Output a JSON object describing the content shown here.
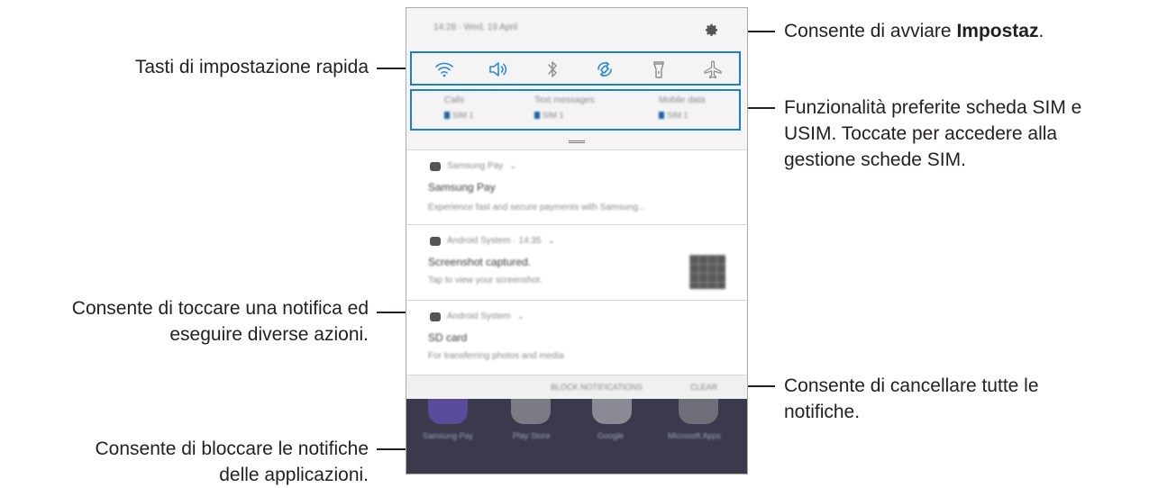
{
  "callouts": {
    "quick_settings": "Tasti di impostazione rapida",
    "settings_prefix": "Consente di avviare ",
    "settings_bold": "Impostaz",
    "settings_suffix": ".",
    "sim_line1": "Funzionalità preferite scheda SIM e",
    "sim_line2": "USIM. Toccate per accedere alla",
    "sim_line3": "gestione schede SIM.",
    "notification_line1": "Consente di toccare una notifica ed",
    "notification_line2": "eseguire diverse azioni.",
    "clear_line1": "Consente di cancellare tutte le",
    "clear_line2": "notifiche.",
    "block_line1": "Consente di bloccare le notifiche",
    "block_line2": "delle applicazioni."
  },
  "phone": {
    "status_time": "14:28 · Wed, 19 April",
    "quick_toggles": [
      "wifi-icon",
      "sound-icon",
      "bluetooth-icon",
      "auto-rotate-icon",
      "flashlight-icon",
      "airplane-mode-icon"
    ],
    "accent_color": "#1b7fd1",
    "sim": [
      {
        "title": "Calls",
        "value": "SIM 1"
      },
      {
        "title": "Text messages",
        "value": "SIM 1"
      },
      {
        "title": "Mobile data",
        "value": "SIM 1"
      }
    ],
    "notifications": [
      {
        "app": "Samsung Pay",
        "title": "Samsung Pay",
        "text": "Experience fast and secure payments with Samsung..."
      },
      {
        "app": "Android System · 14:35",
        "title": "Screenshot captured.",
        "text": "Tap to view your screenshot."
      },
      {
        "app": "Android System",
        "title": "SD card",
        "text": "For transferring photos and media"
      }
    ],
    "block_button": "BLOCK NOTIFICATIONS",
    "clear_button": "CLEAR",
    "dock": [
      "Samsung Pay",
      "Play Store",
      "Google",
      "Microsoft Apps"
    ]
  }
}
